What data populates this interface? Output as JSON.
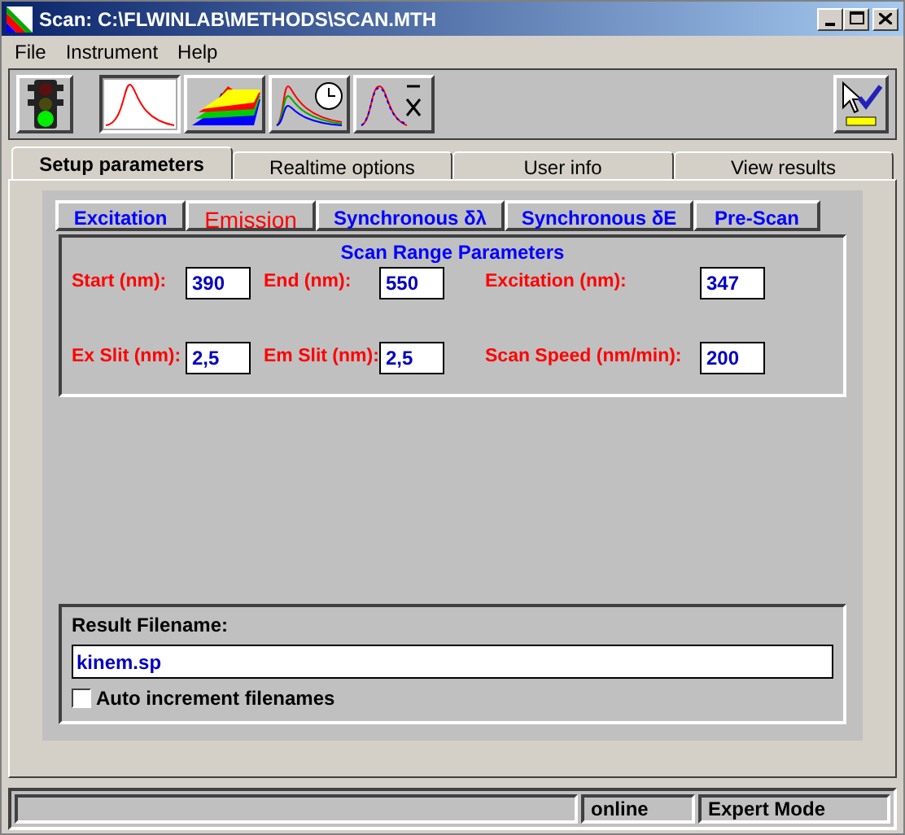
{
  "window": {
    "title": "Scan: C:\\FLWINLAB\\METHODS\\SCAN.MTH"
  },
  "menu": [
    "File",
    "Instrument",
    "Help"
  ],
  "toolbar": [
    {
      "kind": "traffic",
      "selected": false
    },
    {
      "kind": "spectrum",
      "selected": true
    },
    {
      "kind": "stack",
      "selected": false
    },
    {
      "kind": "timed",
      "selected": false
    },
    {
      "kind": "average",
      "selected": false
    },
    {
      "kind": "accept",
      "selected": false
    }
  ],
  "tabs": [
    {
      "label": "Setup parameters",
      "selected": true
    },
    {
      "label": "Realtime options",
      "selected": false
    },
    {
      "label": "User info",
      "selected": false
    },
    {
      "label": "View results",
      "selected": false
    }
  ],
  "scan_types": [
    {
      "label": "Excitation",
      "selected": false
    },
    {
      "label": "Emission",
      "selected": true
    },
    {
      "label": "Synchronous δλ",
      "selected": false
    },
    {
      "label": "Synchronous δE",
      "selected": false
    },
    {
      "label": "Pre-Scan",
      "selected": false
    }
  ],
  "scan_range": {
    "title": "Scan Range Parameters",
    "rows": [
      [
        {
          "label": "Start (nm):",
          "value": "390"
        },
        {
          "label": "End (nm):",
          "value": "550"
        },
        {
          "label": "Excitation (nm):",
          "value": "347"
        }
      ],
      [
        {
          "label": "Ex Slit (nm):",
          "value": "2,5"
        },
        {
          "label": "Em Slit (nm):",
          "value": "2,5"
        },
        {
          "label": "Scan Speed (nm/min):",
          "value": "200"
        }
      ]
    ]
  },
  "result": {
    "label": "Result Filename:",
    "value": "kinem.sp",
    "checkbox": {
      "label": "Auto increment filenames",
      "checked": false
    }
  },
  "status_bar": [
    "online",
    "Expert Mode"
  ]
}
